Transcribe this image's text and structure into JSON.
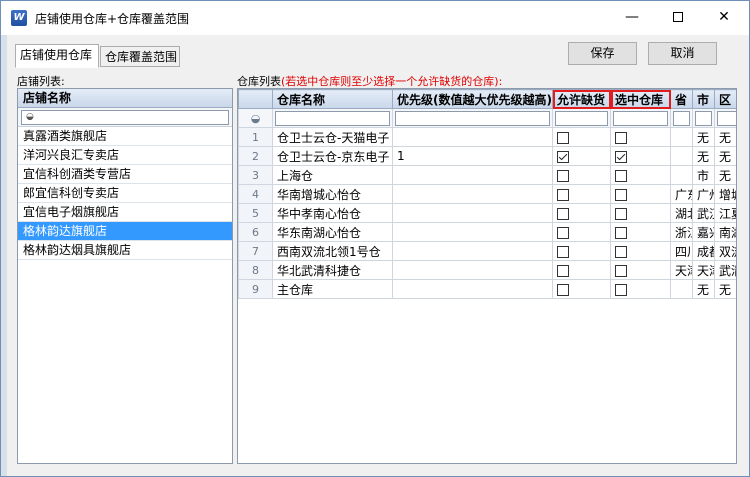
{
  "window": {
    "title": "店铺使用仓库+仓库覆盖范围",
    "app_icon_glyph": "W",
    "buttons": {
      "minimize": "—",
      "close": "✕"
    }
  },
  "tabs": [
    {
      "label": "店铺使用仓库",
      "active": true
    },
    {
      "label": "仓库覆盖范围",
      "active": false
    }
  ],
  "toolbar": {
    "save_label": "保存",
    "cancel_label": "取消"
  },
  "store_panel": {
    "label": "店铺列表:",
    "column": "店铺名称",
    "filter_icon": "filter-icon",
    "stores": [
      {
        "name": "真露酒类旗舰店"
      },
      {
        "name": "洋河兴良汇专卖店"
      },
      {
        "name": "宜信科创酒类专营店"
      },
      {
        "name": "郎宜信科创专卖店"
      },
      {
        "name": "宜信电子烟旗舰店"
      },
      {
        "name": "格林韵达旗舰店",
        "selected": true
      },
      {
        "name": "格林韵达烟具旗舰店"
      }
    ]
  },
  "warehouse_panel": {
    "label": "仓库列表",
    "hint": "(若选中仓库则至少选择一个允许缺货的仓库):",
    "columns": {
      "name": "仓库名称",
      "priority": "优先级(数值越大优先级越高)",
      "allow_shortage": "允许缺货",
      "selected": "选中仓库",
      "province": "省",
      "city": "市",
      "district": "区"
    },
    "rows": [
      {
        "no": "1",
        "name": "仓卫士云仓-天猫电子",
        "priority": "",
        "allow": false,
        "sel": false,
        "province": "",
        "city": "无",
        "district": "无"
      },
      {
        "no": "2",
        "name": "仓卫士云仓-京东电子",
        "priority": "1",
        "allow": true,
        "sel": true,
        "province": "",
        "city": "无",
        "district": "无"
      },
      {
        "no": "3",
        "name": "上海仓",
        "priority": "",
        "allow": false,
        "sel": false,
        "province": "",
        "city": "市",
        "district": "无"
      },
      {
        "no": "4",
        "name": "华南增城心怡仓",
        "priority": "",
        "allow": false,
        "sel": false,
        "province": "广东",
        "city": "广州",
        "district": "增城"
      },
      {
        "no": "5",
        "name": "华中孝南心怡仓",
        "priority": "",
        "allow": false,
        "sel": false,
        "province": "湖北",
        "city": "武汉",
        "district": "江夏"
      },
      {
        "no": "6",
        "name": "华东南湖心怡仓",
        "priority": "",
        "allow": false,
        "sel": false,
        "province": "浙江",
        "city": "嘉兴",
        "district": "南湖"
      },
      {
        "no": "7",
        "name": "西南双流北领1号仓",
        "priority": "",
        "allow": false,
        "sel": false,
        "province": "四川",
        "city": "成都",
        "district": "双流"
      },
      {
        "no": "8",
        "name": "华北武清科捷仓",
        "priority": "",
        "allow": false,
        "sel": false,
        "province": "天津",
        "city": "天津",
        "district": "武清"
      },
      {
        "no": "9",
        "name": "主仓库",
        "priority": "",
        "allow": false,
        "sel": false,
        "province": "",
        "city": "无",
        "district": "无"
      }
    ]
  },
  "colors": {
    "selection": "#3399ff",
    "highlight_border": "#e21d1d",
    "hint_text": "#e00000"
  }
}
